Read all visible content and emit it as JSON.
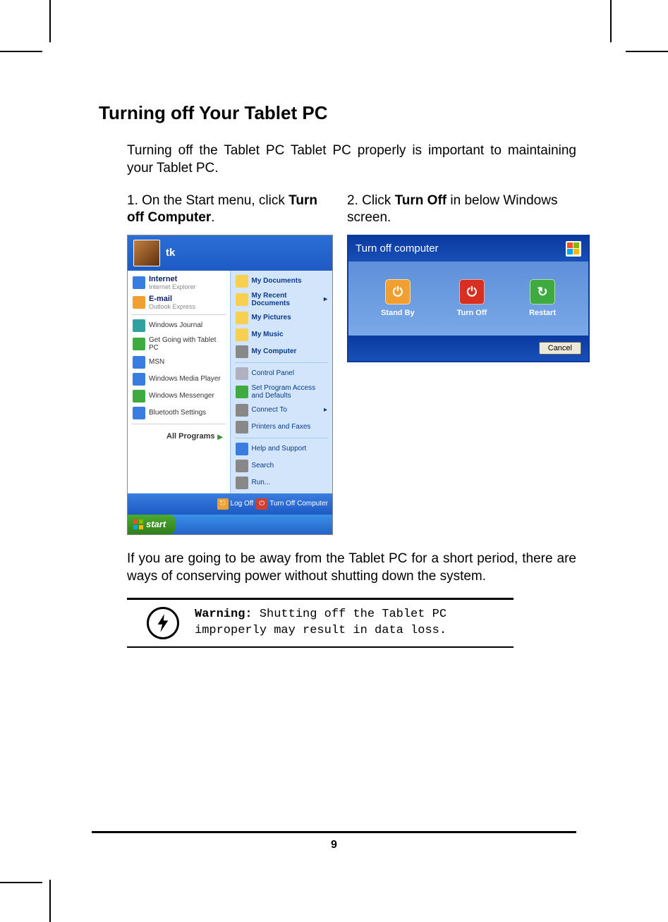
{
  "heading": "Turning off Your Tablet PC",
  "intro": "Turning off the Tablet PC Tablet PC properly is important to maintaining your Tablet PC.",
  "step1_pre": "1. On the Start menu, click ",
  "step1_bold": "Turn off Computer",
  "step1_post": ".",
  "step2_pre": "2. Click ",
  "step2_bold": "Turn Off",
  "step2_post": " in below Windows screen.",
  "after": "If you are going to be away from the Tablet PC for a short period, there are ways of conserving power without shutting down the system.",
  "warning_label": "Warning:",
  "warning_text": " Shutting off the Tablet PC improperly may result in data loss.",
  "page_number": "9",
  "startmenu": {
    "user": "tk",
    "left": {
      "internet_title": "Internet",
      "internet_sub": "Internet Explorer",
      "email_title": "E-mail",
      "email_sub": "Outlook Express",
      "items": [
        "Windows Journal",
        "Get Going with Tablet PC",
        "MSN",
        "Windows Media Player",
        "Windows Messenger",
        "Bluetooth Settings"
      ],
      "all_programs": "All Programs"
    },
    "right": {
      "items": [
        "My Documents",
        "My Recent Documents",
        "My Pictures",
        "My Music",
        "My Computer",
        "Control Panel",
        "Set Program Access and Defaults",
        "Connect To",
        "Printers and Faxes",
        "Help and Support",
        "Search",
        "Run..."
      ]
    },
    "bottom": {
      "logoff": "Log Off",
      "turnoff": "Turn Off Computer"
    },
    "start_button": "start"
  },
  "dialog": {
    "title": "Turn off computer",
    "standby": "Stand By",
    "turnoff": "Turn Off",
    "restart": "Restart",
    "cancel": "Cancel"
  }
}
